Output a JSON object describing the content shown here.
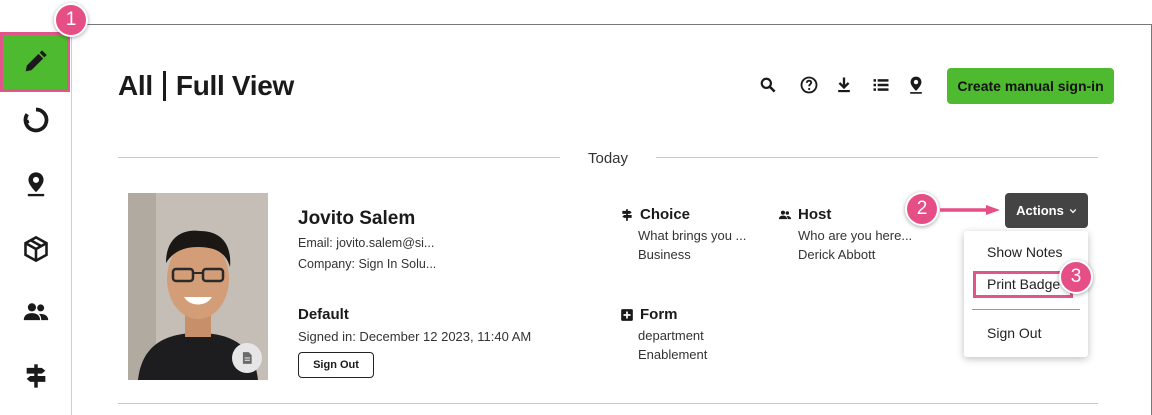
{
  "header": {
    "title_part1": "All",
    "title_part2": "Full View",
    "create_button": "Create manual sign-in"
  },
  "toolbar": {
    "icons": [
      "search-icon",
      "help-icon",
      "download-icon",
      "list-icon",
      "location-pin-icon"
    ]
  },
  "sidebar": {
    "items": [
      "pen-icon",
      "loading-ring-icon",
      "location-icon",
      "package-icon",
      "people-icon",
      "signpost-icon"
    ]
  },
  "callouts": {
    "one": "1",
    "two": "2",
    "three": "3"
  },
  "list": {
    "group_label": "Today"
  },
  "visitor": {
    "name": "Jovito Salem",
    "email": "Email: jovito.salem@si...",
    "company": "Company: Sign In Solu...",
    "location": "Default",
    "signed_in": "Signed in: December 12 2023, 11:40 AM",
    "signout_button": "Sign Out",
    "choice_label": "Choice",
    "choice_question": "What brings you ...",
    "choice_value": "Business",
    "host_label": "Host",
    "host_question": "Who are you here...",
    "host_value": "Derick Abbott",
    "form_label": "Form",
    "form_field": "department",
    "form_value": "Enablement"
  },
  "actions": {
    "button": "Actions",
    "menu": [
      "Show Notes",
      "Print Badge",
      "Sign Out"
    ]
  },
  "colors": {
    "brand_green": "#4dba2f",
    "callout_pink": "#e64f85",
    "actions_dark": "#444444"
  }
}
